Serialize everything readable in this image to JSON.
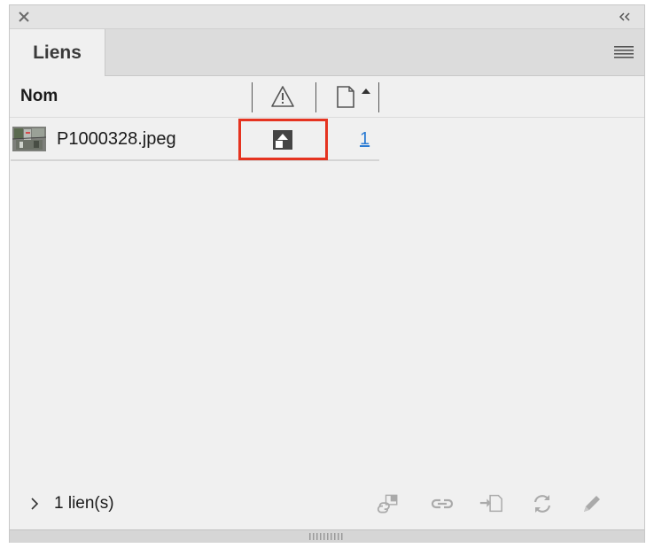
{
  "panel": {
    "tab_label": "Liens"
  },
  "columns": {
    "name_label": "Nom",
    "status_icon": "warning-icon",
    "page_icon": "page-icon"
  },
  "links": [
    {
      "filename": "P1000328.jpeg",
      "status_icon": "embedded-icon",
      "page": "1"
    }
  ],
  "footer": {
    "count_label": "1 lien(s)",
    "tools": [
      "relink-from-cc-library-icon",
      "relink-icon",
      "go-to-link-icon",
      "update-link-icon",
      "edit-original-icon"
    ]
  },
  "colors": {
    "highlight": "#e53320",
    "link": "#2b7bd3",
    "panel_bg": "#f0f0f0"
  }
}
